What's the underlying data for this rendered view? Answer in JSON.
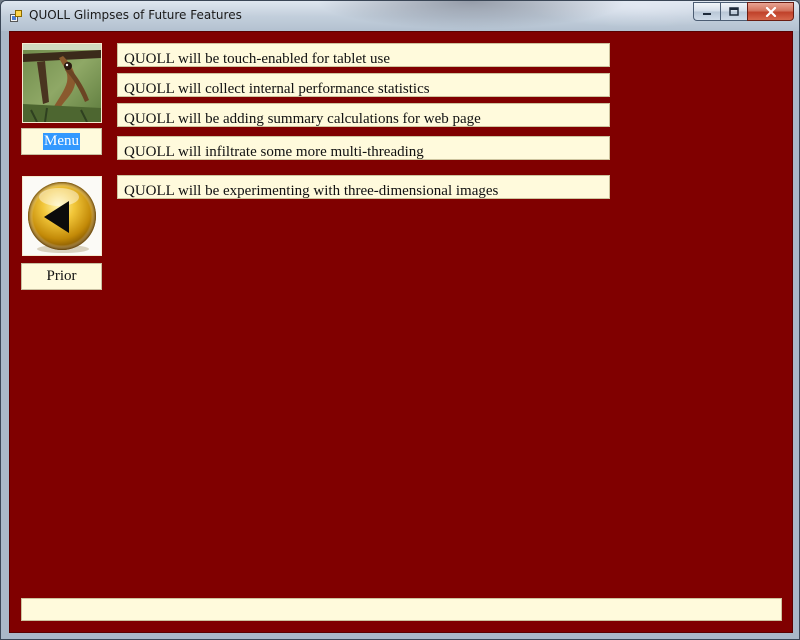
{
  "window": {
    "title": "QUOLL Glimpses of Future Features"
  },
  "sidebar": {
    "menu_label": "Menu",
    "prior_label": "Prior",
    "menu_image": "animal-on-branch-photo",
    "prior_image": "gold-back-arrow-orb-icon"
  },
  "features": [
    "QUOLL will be touch-enabled for tablet use",
    "QUOLL will collect internal performance statistics",
    "QUOLL will be adding summary calculations for web page",
    "QUOLL will infiltrate some more multi-threading",
    "QUOLL will be experimenting with three-dimensional images"
  ],
  "status": {
    "text": ""
  },
  "colors": {
    "background": "#800000",
    "panel": "#fffadc",
    "selection": "#3399ff"
  }
}
